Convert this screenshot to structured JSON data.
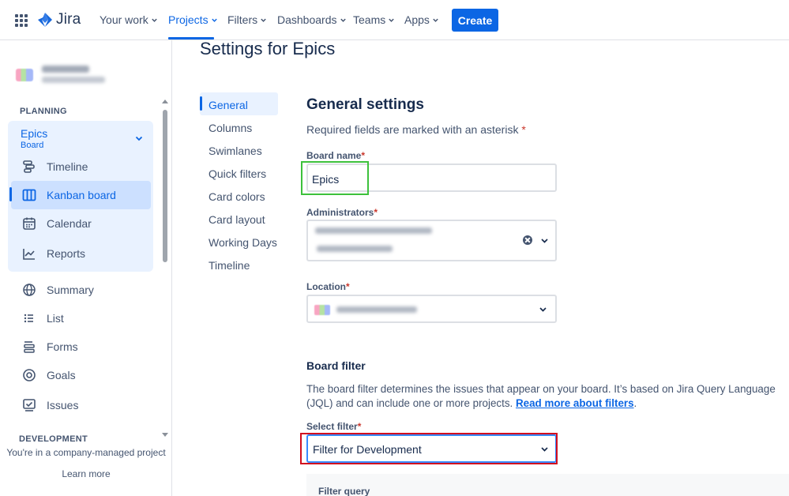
{
  "topnav": {
    "logo_text": "Jira",
    "items": [
      {
        "label": "Your work"
      },
      {
        "label": "Projects"
      },
      {
        "label": "Filters"
      },
      {
        "label": "Dashboards"
      },
      {
        "label": "Teams"
      },
      {
        "label": "Apps"
      }
    ],
    "create_label": "Create",
    "accent_color": "#0c66e4"
  },
  "sidebar": {
    "planning_heading": "PLANNING",
    "group": {
      "title": "Epics",
      "subtitle": "Board"
    },
    "planning_items": [
      {
        "label": "Timeline",
        "icon": "timeline-icon"
      },
      {
        "label": "Kanban board",
        "icon": "kanban-icon"
      },
      {
        "label": "Calendar",
        "icon": "calendar-icon"
      },
      {
        "label": "Reports",
        "icon": "reports-icon"
      }
    ],
    "other_items": [
      {
        "label": "Summary",
        "icon": "globe-icon"
      },
      {
        "label": "List",
        "icon": "list-icon"
      },
      {
        "label": "Forms",
        "icon": "forms-icon"
      },
      {
        "label": "Goals",
        "icon": "goals-icon"
      },
      {
        "label": "Issues",
        "icon": "issues-icon"
      }
    ],
    "development_heading": "DEVELOPMENT",
    "footer_note": "You're in a company-managed project",
    "learn_more": "Learn more"
  },
  "page": {
    "title": "Settings for Epics",
    "subnav": [
      {
        "label": "General"
      },
      {
        "label": "Columns"
      },
      {
        "label": "Swimlanes"
      },
      {
        "label": "Quick filters"
      },
      {
        "label": "Card colors"
      },
      {
        "label": "Card layout"
      },
      {
        "label": "Working Days"
      },
      {
        "label": "Timeline"
      }
    ]
  },
  "general": {
    "heading": "General settings",
    "required_note": "Required fields are marked with an asterisk",
    "asterisk": "*",
    "board_name_label": "Board name",
    "board_name_value": "Epics",
    "administrators_label": "Administrators",
    "location_label": "Location"
  },
  "board_filter": {
    "heading": "Board filter",
    "description": "The board filter determines the issues that appear on your board. It’s based on Jira Query Language (JQL) and can include one or more projects.",
    "link": "Read more about filters",
    "after_link": ".",
    "select_label": "Select filter",
    "select_value": "Filter for Development",
    "filter_query_label": "Filter query"
  }
}
